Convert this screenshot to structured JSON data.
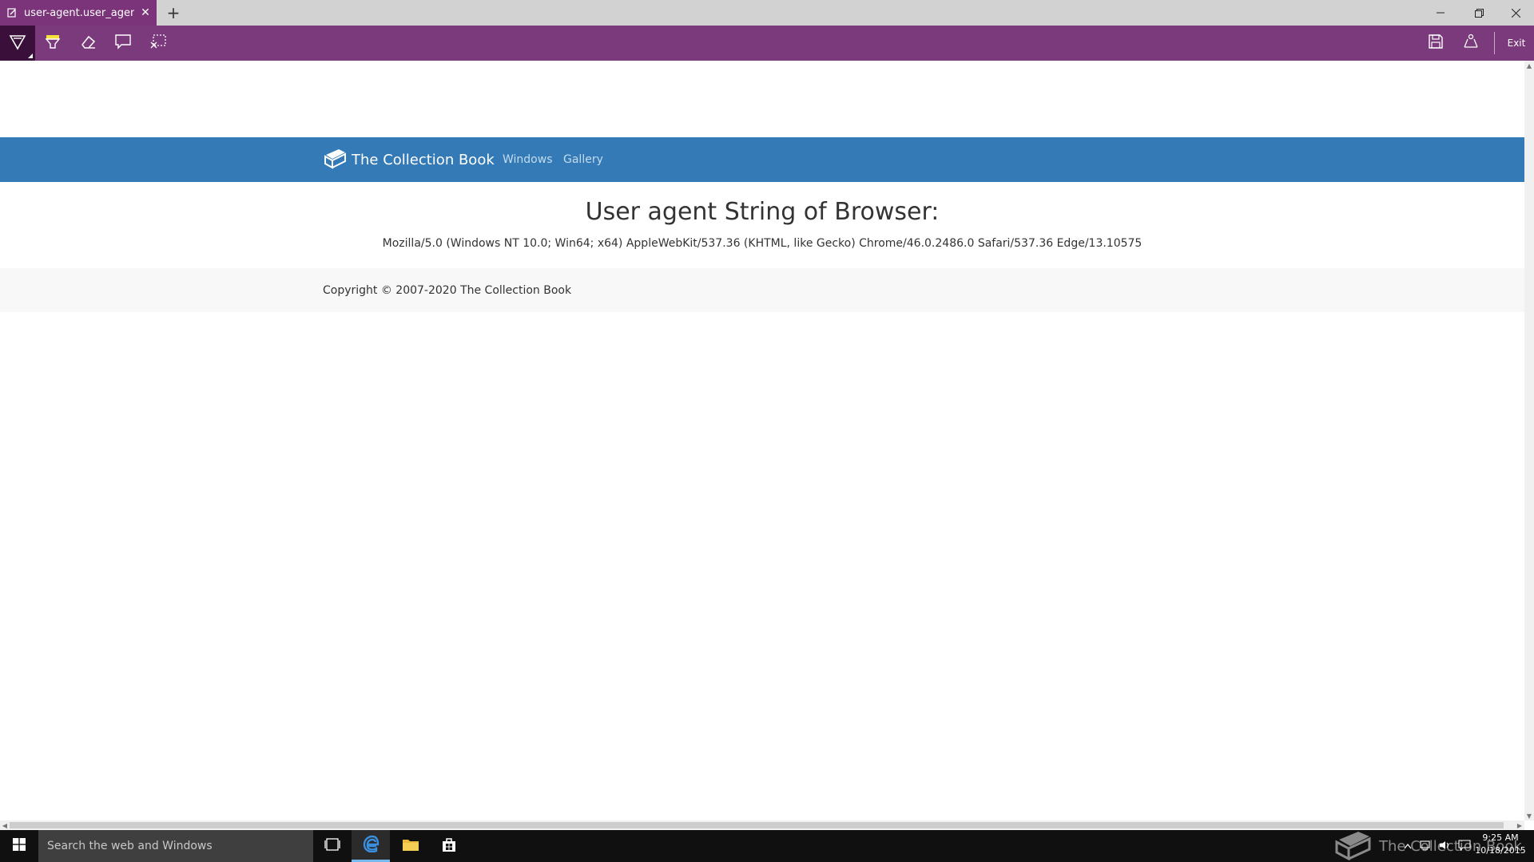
{
  "browser": {
    "tab_title": "user-agent.user_agent -",
    "tab_close": "✕",
    "new_tab": "+",
    "window_controls": {
      "minimize": "—",
      "restore": "❐",
      "close": "✕"
    }
  },
  "toolbar": {
    "tools": [
      "pen-icon",
      "highlighter-icon",
      "eraser-icon",
      "comment-icon",
      "clip-icon"
    ],
    "exit_label": "Exit",
    "accent": "#7b3a7b"
  },
  "page": {
    "brand": "The Collection Book",
    "nav": [
      "Windows",
      "Gallery"
    ],
    "heading": "User agent String of Browser:",
    "user_agent": "Mozilla/5.0 (Windows NT 10.0; Win64; x64) AppleWebKit/537.36 (KHTML, like Gecko) Chrome/46.0.2486.0 Safari/537.36 Edge/13.10575",
    "copyright": "Copyright © 2007-2020 The Collection Book",
    "navbar_color": "#337ab7"
  },
  "taskbar": {
    "search_placeholder": "Search the web and Windows",
    "watermark": "The Collection Book",
    "time": "9:25 AM",
    "date": "10/18/2015"
  }
}
